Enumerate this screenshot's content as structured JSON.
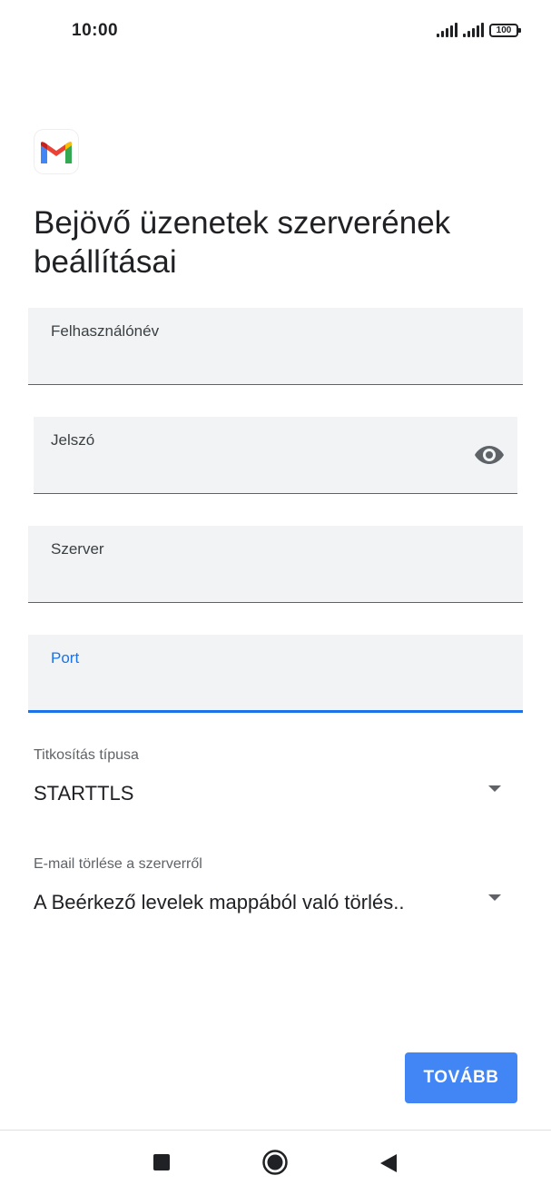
{
  "status_bar": {
    "time": "10:00",
    "battery": "100"
  },
  "page": {
    "title": "Bejövő üzenetek szerverének beállításai"
  },
  "fields": {
    "username": {
      "label": "Felhasználónév",
      "value": ""
    },
    "password": {
      "label": "Jelszó",
      "value": ""
    },
    "server": {
      "label": "Szerver",
      "value": ""
    },
    "port": {
      "label": "Port",
      "value": ""
    }
  },
  "dropdowns": {
    "encryption": {
      "label": "Titkosítás típusa",
      "selected": "STARTTLS"
    },
    "delete_from_server": {
      "label": "E-mail törlése a szerverről",
      "selected": "A Beérkező levelek mappából való törlés.."
    }
  },
  "actions": {
    "next_label": "TOVÁBB"
  },
  "icons": {
    "logo": "gmail-logo-icon",
    "password_toggle": "eye-icon",
    "nav_recent": "square-icon",
    "nav_home": "circle-icon",
    "nav_back": "triangle-back-icon"
  },
  "colors": {
    "accent": "#1a73e8",
    "button": "#4285f4",
    "field_bg": "#f1f3f4"
  }
}
